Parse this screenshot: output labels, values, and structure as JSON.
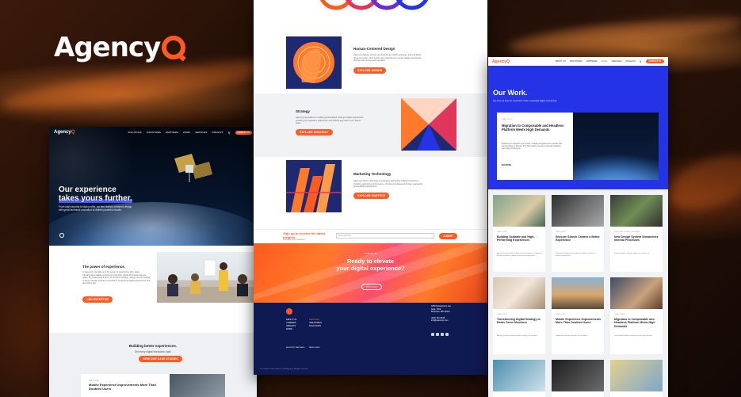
{
  "brand": {
    "logo_text": "Agency",
    "logo_letter": "Q",
    "accent": "#ff5a1f",
    "navy": "#101a52",
    "blue": "#2433e6"
  },
  "left_site": {
    "nav": {
      "brand": "AgencyQ",
      "items": [
        "SOLUTIONS",
        "INDUSTRIES",
        "PARTNERS",
        "WORK",
        "SERVICES",
        "INSIGHTS"
      ],
      "cta": "CONTACT US"
    },
    "hero": {
      "title_line1": "Our experience",
      "title_line2": "takes yours further.",
      "body": "From high security to high profile, we flex human-centered design with great technical execution to deliver powerful results."
    },
    "power": {
      "title": "The power of experience.",
      "body": "At AgencyQ, we believe in the power of experience. We create transformative digital experiences that drive results for brands that are better. By putting people first, we combine strategy, design, and technology to solve complex problems and deliver exceptional digital experiences that are built to last.",
      "button": "OUR EXPERTISE"
    },
    "better": {
      "title": "Building better experiences.",
      "subtitle": "Get every digital interaction right.",
      "button": "VIEW OUR CASE STUDIES"
    },
    "case": {
      "tag": "AMI STUDY",
      "title": "Mobile Experience Improvements More Than Doubled Users"
    }
  },
  "center_site": {
    "services": [
      {
        "title": "Human-Centered Design",
        "body": "AgencyQ delivers human-centered design (HCD) practices, learning about those end-users, their needs, and motivations to create digital experiences that are easy to use and enjoyable.",
        "button": "EXPLORE DESIGN"
      },
      {
        "title": "Strategy",
        "body": "AgencyQ specializes in building personalized, strategic digital experiences, providing an integrated, data-driven and tailored approach to our clients' goals.",
        "button": "EXPLORE STRATEGY"
      },
      {
        "title": "Marketing Technology",
        "body": "AgencyQ offers a full range of marketing technology (MarTech) services, including optimizing performance, unifying your data and driving meaningful, personalized experiences.",
        "button": "EXPLORE MARTECH"
      }
    ],
    "signup": {
      "label": "Sign up to receive the latest insights.",
      "sub": "Subscribe to our newsletter",
      "placeholder": "Email Address*",
      "button": "SUBMIT"
    },
    "cta": {
      "kicker": "CONTACT US",
      "title_line1": "Ready to elevate",
      "title_line2": "your digital experience?",
      "button": "LET'S TALK"
    },
    "footer": {
      "col1": [
        "ABOUT US",
        "CAREERS",
        "INSIGHTS",
        "WORK"
      ],
      "col2": [
        "SERVICES",
        "INDUSTRIES",
        "SOLUTIONS"
      ],
      "address": [
        "4350 Montgomery Ave",
        "Suite 725S",
        "Bethesda, MD 20814"
      ],
      "phone": [
        "(202) 791-0838",
        "info@agencyq.com"
      ],
      "partners_title": "INDUSTRY PARTNERS",
      "news_title": "NEWS LINKS",
      "legal": "The contents of this website © 2024 AgencyQ. All rights reserved."
    }
  },
  "right_site": {
    "nav": {
      "brand": "AgencyQ",
      "items": [
        "ABOUT US",
        "INDUSTRIES",
        "PARTNERS",
        "WORK",
        "SERVICES",
        "INSIGHTS"
      ],
      "cta": "CONTACT US"
    },
    "hero": {
      "title": "Our Work.",
      "body": "See how we help our customers create meaningful digital experiences."
    },
    "featured": {
      "tag": "CASE STUDY",
      "title": "Migration to Composable and Headless Platform Meets High Demands",
      "body": "Workshop of Institution’s generation, enabling integration from website that demonstrates on Sitecore XM, This solution met and technically standard, improving performance.",
      "more": "SEE MORE"
    },
    "cards": [
      {
        "tag": "CASE STUDY",
        "title": "Building Scalable and High-Performing Experiences",
        "body": "AgencyQ worked with the American Association of Colleges of Nursing to build a scalable, high-performing website."
      },
      {
        "tag": "CASE STUDY",
        "title": "Sitecore Search Creates a Better Experience",
        "body": "Working with AgencyQ to implement Sitecore Search to improve experience."
      },
      {
        "tag": "PERSONAL DIGITAL CONSUMER",
        "title": "New Design System Streamlines Internal Processes",
        "body": "Implementation of design system for internal use."
      },
      {
        "tag": "CASE STUDY",
        "title": "Transforming Digital Strategy to Better Serve Members",
        "body": "AgencyQ helped transform digital strategy for members."
      },
      {
        "tag": "CASE STUDY",
        "title": "Mobile Experience Improvements More Than Doubled Users",
        "body": "Mobile-first redesign doubled user numbers."
      },
      {
        "tag": "CASE STUDY",
        "title": "Migration to Composable and Headless Platform Meets High Demands",
        "body": "Composable platform migration meets high demand."
      }
    ]
  }
}
